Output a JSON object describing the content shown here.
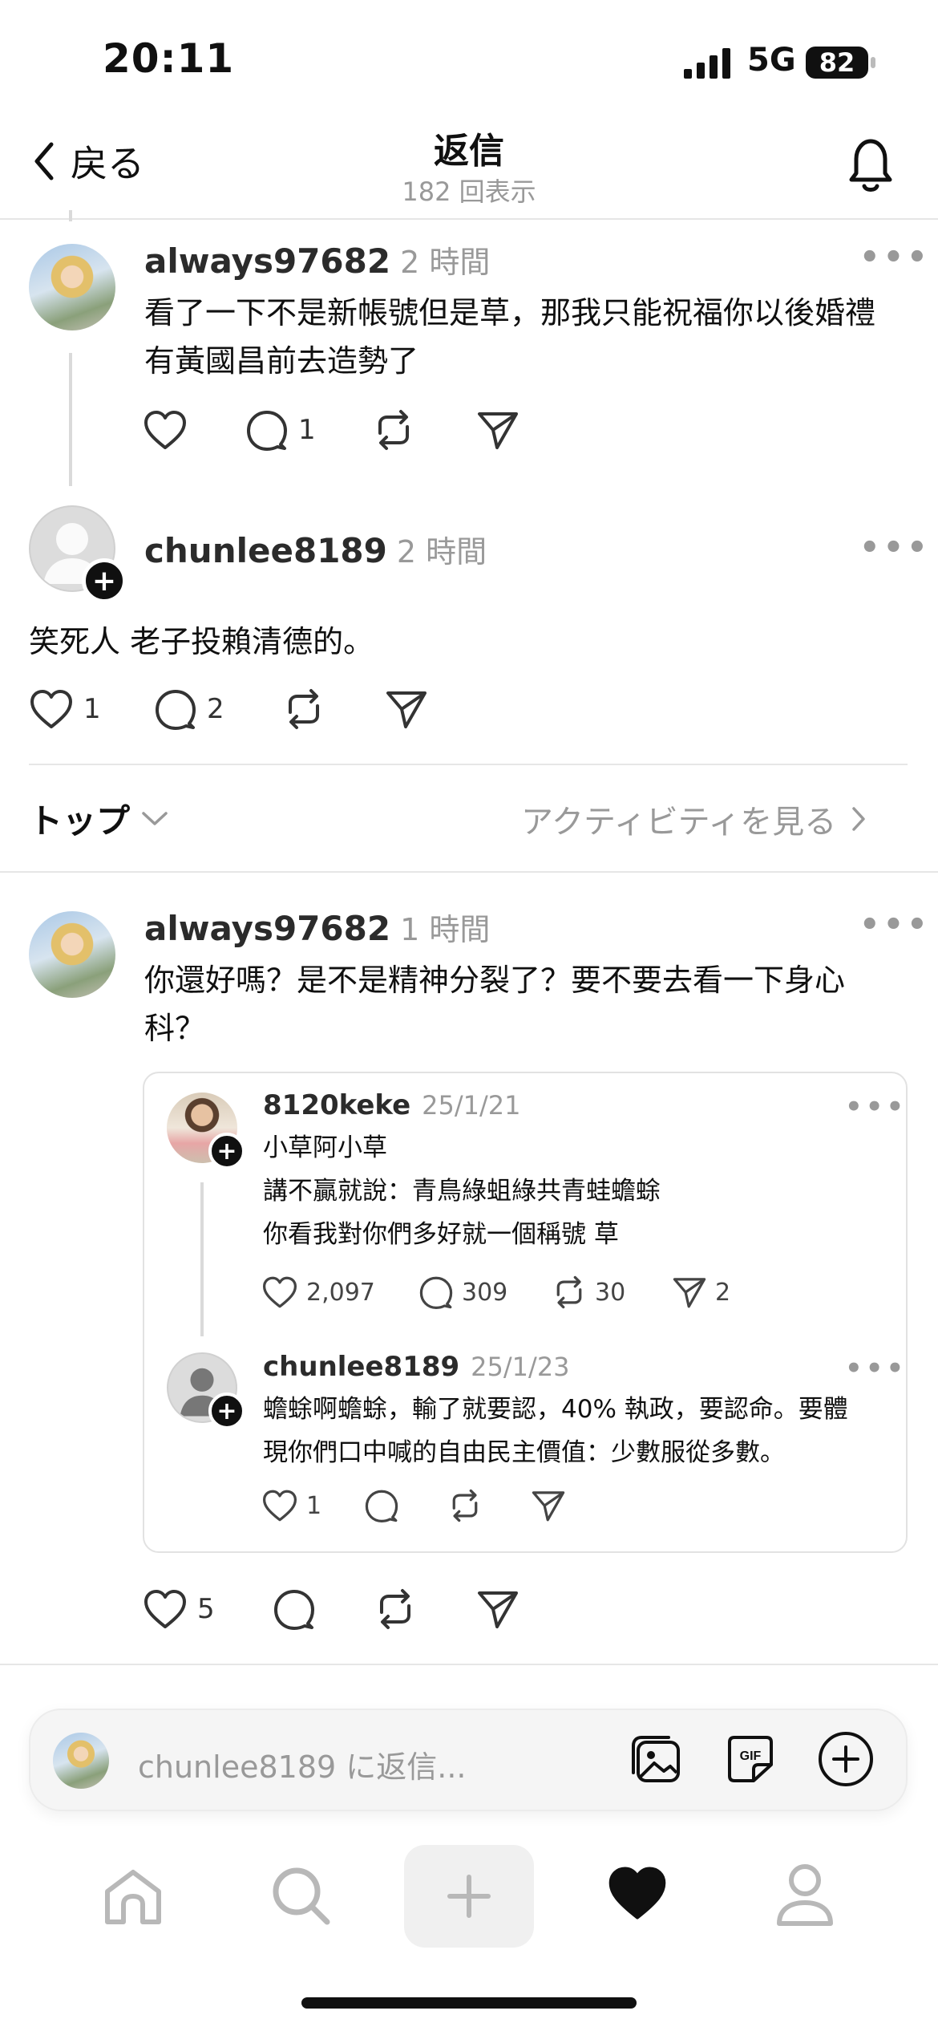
{
  "status_bar": {
    "time": "20:11",
    "network": "5G",
    "battery": "82"
  },
  "header": {
    "back_label": "戻る",
    "title": "返信",
    "subtitle": "182 回表示"
  },
  "posts": [
    {
      "username": "always97682",
      "time": "2 時間",
      "text_lines": [
        "看了一下不是新帳號但是草，那我只能祝福你以後婚禮",
        "有黃國昌前去造勢了"
      ],
      "reply_count": "1"
    },
    {
      "username": "chunlee8189",
      "time": "2 時間",
      "text": "笑死人 老子投賴清德的。",
      "like_count": "1",
      "reply_count": "2"
    }
  ],
  "sort": {
    "label": "トップ",
    "activity_label": "アクティビティを見る"
  },
  "reply_post": {
    "username": "always97682",
    "time": "1 時間",
    "text_lines": [
      "你還好嗎？是不是精神分裂了？要不要去看一下身心",
      "科？"
    ],
    "like_count": "5"
  },
  "quote": {
    "first": {
      "username": "8120keke",
      "date": "25/1/21",
      "lines": [
        "小草阿小草",
        "講不贏就說：青鳥綠蛆綠共青蛙蟾蜍",
        "你看我對你們多好就一個稱號 草"
      ],
      "likes": "2,097",
      "replies": "309",
      "reposts": "30",
      "shares": "2"
    },
    "second": {
      "username": "chunlee8189",
      "date": "25/1/23",
      "lines": [
        "蟾蜍啊蟾蜍，輸了就要認，40% 執政，要認命。要體",
        "現你們口中喊的自由民主價值：少數服從多數。"
      ],
      "likes": "1"
    }
  },
  "reply_bar": {
    "placeholder": "chunlee8189 に返信..."
  },
  "colors": {
    "text": "#101010",
    "muted": "#999999",
    "divider": "#e6e6e6"
  }
}
